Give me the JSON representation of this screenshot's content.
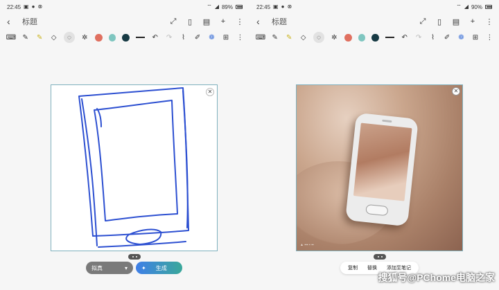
{
  "left": {
    "status": {
      "time": "22:45",
      "battery": "89%"
    },
    "title": "标题",
    "drawing_tools": [
      "keyboard-icon",
      "pen-icon",
      "highlighter-icon",
      "eraser-icon",
      "lasso-icon",
      "magic-icon"
    ],
    "colors": [
      "#e07060",
      "#7fc6c0",
      "#173a44"
    ],
    "style_select": {
      "value": "拟真"
    },
    "generate_button": {
      "label": "生成"
    }
  },
  "right": {
    "status": {
      "time": "22:45",
      "battery": "90%"
    },
    "title": "标题",
    "colors": [
      "#e07060",
      "#7fc6c0",
      "#173a44"
    ],
    "actions": [
      "复制",
      "替换",
      "添加至笔记"
    ]
  },
  "watermark": "搜狐号@PChome电脑之家"
}
